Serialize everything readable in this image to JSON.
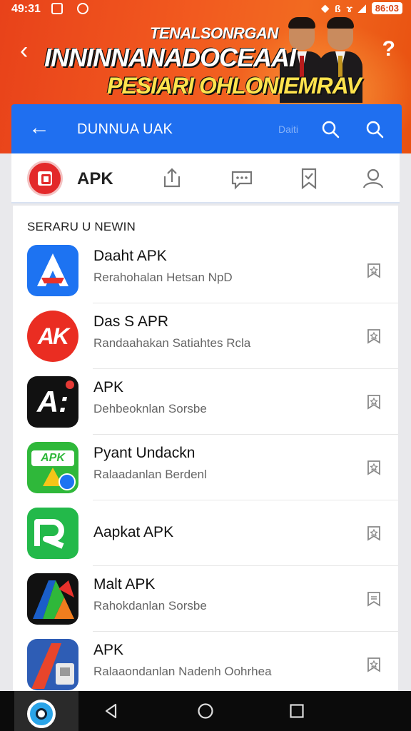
{
  "status_bar": {
    "time": "49:31",
    "battery": "86:03"
  },
  "banner": {
    "line1": "TENALSONRGAN",
    "line2": "INNINNANADOCEAAI",
    "line3": "PESIARI OHLONIEMRAV"
  },
  "search_bar": {
    "title": "DUNNUA UAK",
    "hint": "Daiti"
  },
  "tab_bar": {
    "label": "APK"
  },
  "list": {
    "section_title": "SERARU U NEWIN",
    "items": [
      {
        "name": "Daaht APK",
        "desc": "Rerahohalan Hetsan NpD",
        "icon_name": "a-triangle-app-icon",
        "color": "#1d73f2"
      },
      {
        "name": "Das S APR",
        "desc": "Randaahakan Satiahtes Rcla",
        "icon_name": "ak-circle-app-icon",
        "color": "#ea2d22"
      },
      {
        "name": "APK",
        "desc": "Dehbeoknlan Sorsbe",
        "icon_name": "a-black-app-icon",
        "color": "#111111"
      },
      {
        "name": "Pyant Undackn",
        "desc": "Ralaadanlan Berdenl",
        "icon_name": "apk-green-app-icon",
        "color": "#2fb83a"
      },
      {
        "name": "Aapkat APK",
        "desc": "",
        "icon_name": "r-green-app-icon",
        "color": "#23b94a"
      },
      {
        "name": "Malt APK",
        "desc": "Rahokdanlan Sorsbe",
        "icon_name": "colorful-a-app-icon",
        "color": "#1a5ec8"
      },
      {
        "name": "APK",
        "desc": "Ralaaondanlan Nadenh Oohrhea",
        "icon_name": "red-blue-app-icon",
        "color": "#2e5db5"
      }
    ]
  },
  "colors": {
    "banner_orange": "#f25a1f",
    "search_blue": "#1f6ff0",
    "nav_black": "#0b0b0b"
  }
}
